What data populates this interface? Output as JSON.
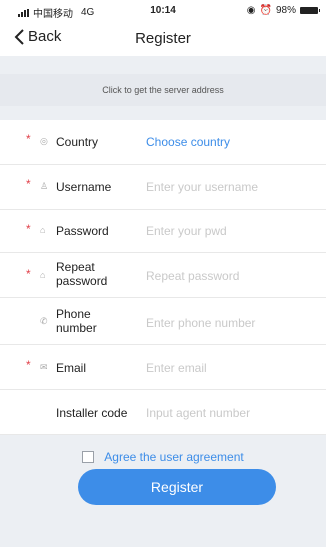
{
  "status": {
    "carrier": "中国移动",
    "network": "4G",
    "time": "10:14",
    "battery": "98%"
  },
  "nav": {
    "back_label": "Back",
    "title": "Register"
  },
  "server": {
    "label": "Click to get the server address"
  },
  "fields": [
    {
      "label": "Country",
      "value": "Choose country",
      "required": true,
      "icon": "globe-icon"
    },
    {
      "label": "Username",
      "value": "Enter your username",
      "required": true,
      "icon": "user-icon"
    },
    {
      "label": "Password",
      "value": "Enter your pwd",
      "required": true,
      "icon": "lock-icon"
    },
    {
      "label": "Repeat\npassword",
      "value": "Repeat password",
      "required": true,
      "icon": "lock-icon"
    },
    {
      "label": "Phone\nnumber",
      "value": "Enter phone number",
      "required": false,
      "icon": "phone-icon"
    },
    {
      "label": "Email",
      "value": "Enter email",
      "required": true,
      "icon": "mail-icon"
    },
    {
      "label": "Installer code",
      "value": "Input agent number",
      "required": false,
      "icon": ""
    }
  ],
  "agree": {
    "label": "Agree the user agreement"
  },
  "actions": {
    "register_label": "Register"
  },
  "colors": {
    "accent": "#3d8de8",
    "required": "#e1404a",
    "background": "#eceff3"
  }
}
